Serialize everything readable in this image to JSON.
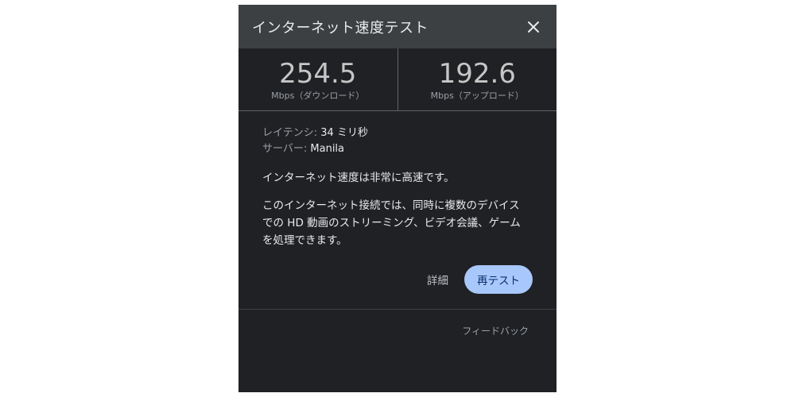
{
  "dialog": {
    "title": "インターネット速度テスト",
    "close_icon": "close-icon"
  },
  "results": {
    "download": {
      "value": "254.5",
      "unit": "Mbps（ダウンロード）"
    },
    "upload": {
      "value": "192.6",
      "unit": "Mbps（アップロード）"
    }
  },
  "info": {
    "latency_label": "レイテンシ:",
    "latency_value": "34 ミリ秒",
    "server_label": "サーバー:",
    "server_value": "Manila"
  },
  "summary": "インターネット速度は非常に高速です。",
  "detail_lines": [
    "このインターネット接続では、同時に複数のデバイス",
    "での HD 動画のストリーミング、ビデオ会議、ゲーム",
    "を処理できます。"
  ],
  "actions": {
    "details_label": "詳細",
    "retest_label": "再テスト"
  },
  "feedback_label": "フィードバック",
  "colors": {
    "panel_bg": "#202124",
    "header_bg": "#3c4043",
    "retest_bg": "#a8c7fa"
  }
}
